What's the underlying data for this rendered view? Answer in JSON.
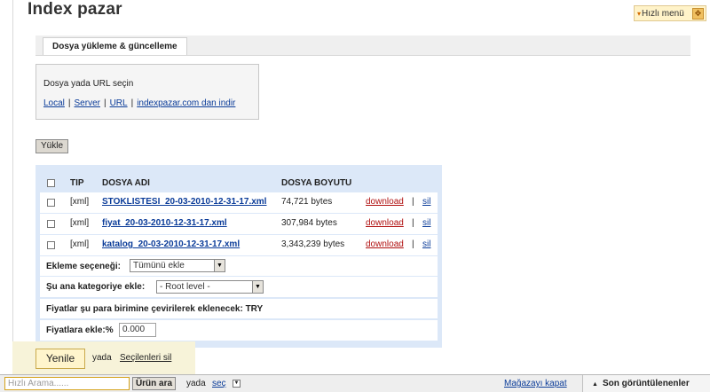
{
  "page": {
    "title": "Index pazar",
    "quick_menu_label": "Hızlı menü",
    "quick_menu_arrow": "▾"
  },
  "tabs": [
    {
      "label": "Dosya yükleme & güncelleme"
    }
  ],
  "file_source": {
    "prompt": "Dosya yada URL seçin",
    "links": [
      "Local",
      "Server",
      "URL",
      "indexpazar.com dan indir"
    ],
    "separator": "|"
  },
  "upload_button_label": "Yükle",
  "table": {
    "headers": {
      "type": "TIP",
      "file_name": "DOSYA ADI",
      "file_size": "DOSYA BOYUTU"
    },
    "rows": [
      {
        "type": "[xml]",
        "file_name": "STOKLISTESI_20-03-2010-12-31-17.xml",
        "size": "74,721 bytes",
        "download": "download",
        "delete": "sil"
      },
      {
        "type": "[xml]",
        "file_name": "fiyat_20-03-2010-12-31-17.xml",
        "size": "307,984 bytes",
        "download": "download",
        "delete": "sil"
      },
      {
        "type": "[xml]",
        "file_name": "katalog_20-03-2010-12-31-17.xml",
        "size": "3,343,239 bytes",
        "download": "download",
        "delete": "sil"
      }
    ],
    "separator": "|"
  },
  "options": {
    "add_option_label": "Ekleme seçeneği:",
    "add_option_value": "Tümünü ekle",
    "category_label": "Şu ana kategoriye ekle:",
    "category_value": "- Root level -",
    "currency_text": "Fiyatlar şu para birimine çevirilerek eklenecek: TRY",
    "price_add_label": "Fiyatlara ekle:%",
    "price_add_value": "0.000"
  },
  "refresh": {
    "button_label": "Yenile",
    "or_text": "yada",
    "delete_selected": "Seçilenleri sil"
  },
  "bottom_bar": {
    "search_placeholder": "Hızlı Arama......",
    "search_button": "Ürün ara",
    "or_text": "yada",
    "select_link": "seç",
    "close_shop": "Mağazayı kapat",
    "recent_label": "Son görüntülenenler"
  }
}
